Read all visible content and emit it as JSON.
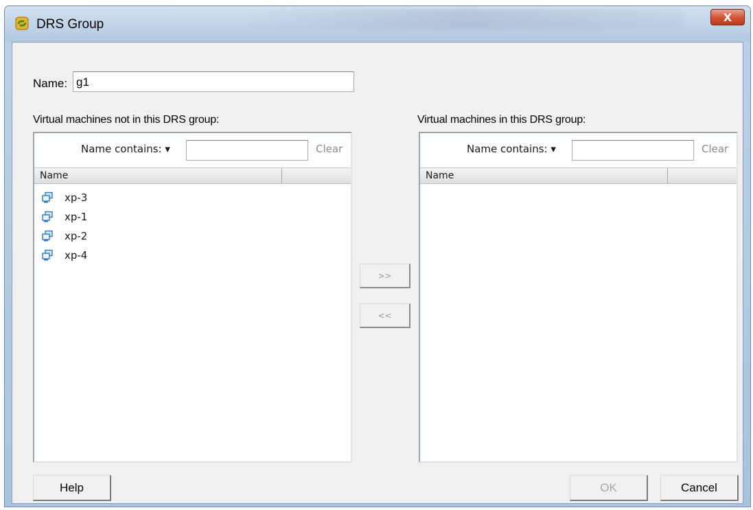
{
  "window": {
    "title": "DRS Group",
    "close_label": "X"
  },
  "name_field": {
    "label": "Name:",
    "value": "g1"
  },
  "left_panel": {
    "heading": "Virtual machines not in this DRS group:",
    "filter_label": "Name contains: ▾",
    "filter_value": "",
    "clear_label": "Clear",
    "column_header": "Name",
    "items": [
      {
        "label": "xp-3",
        "icon": "vm-icon"
      },
      {
        "label": "xp-1",
        "icon": "vm-icon"
      },
      {
        "label": "xp-2",
        "icon": "vm-icon"
      },
      {
        "label": "xp-4",
        "icon": "vm-icon"
      }
    ]
  },
  "right_panel": {
    "heading": "Virtual machines in this DRS group:",
    "filter_label": "Name contains: ▾",
    "filter_value": "",
    "clear_label": "Clear",
    "column_header": "Name",
    "items": []
  },
  "transfer": {
    "add_label": ">>",
    "remove_label": "<<"
  },
  "footer": {
    "help_label": "Help",
    "ok_label": "OK",
    "cancel_label": "Cancel"
  },
  "colors": {
    "title_gradient_top": "#d3e1ef",
    "close_button": "#d2512f",
    "client_bg": "#f0f0f0",
    "vm_icon": "#2f7ac0"
  }
}
